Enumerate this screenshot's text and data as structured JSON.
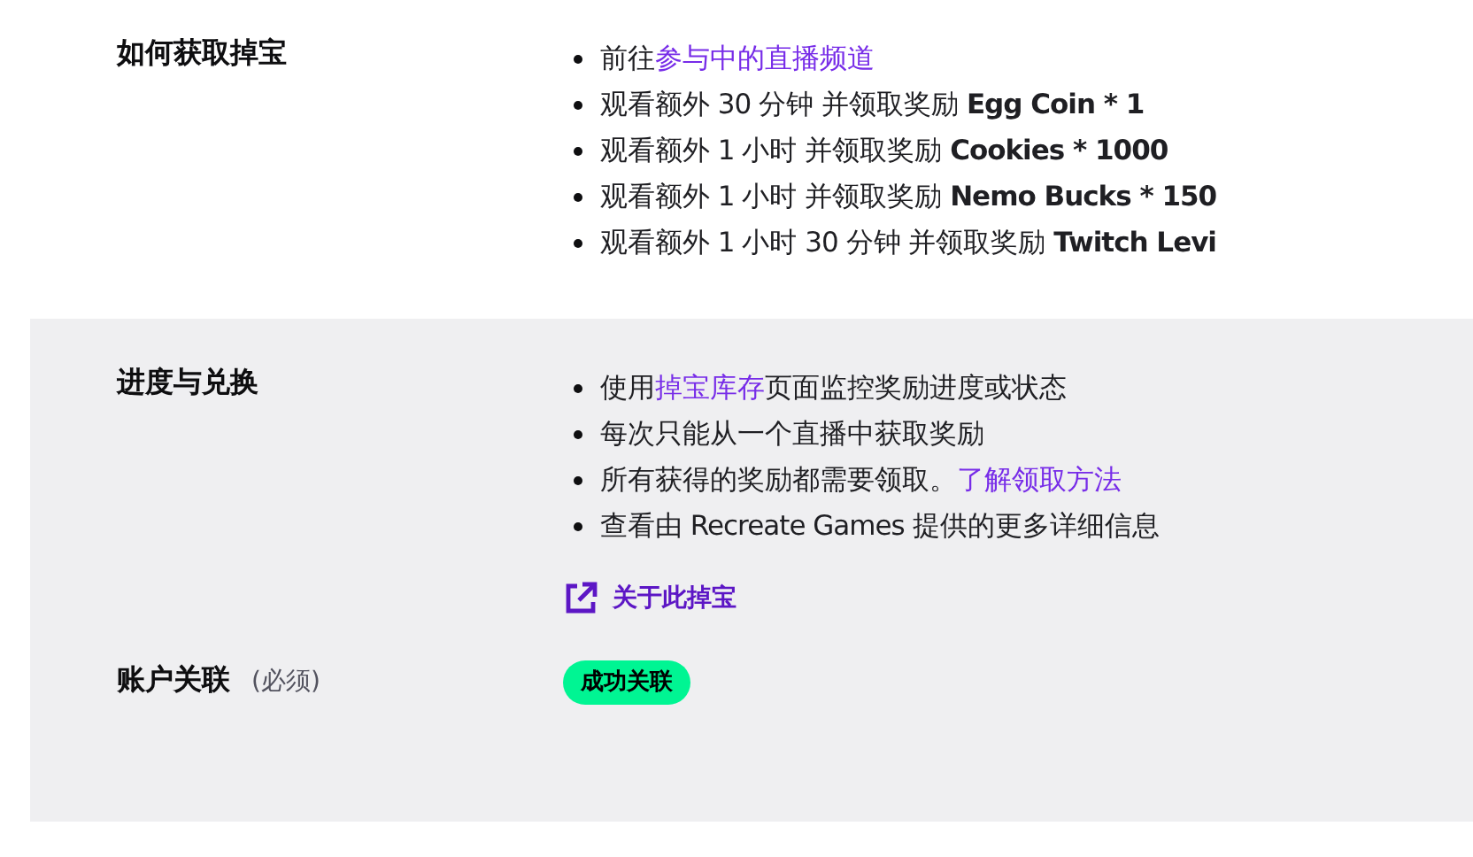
{
  "sections": [
    {
      "shaded": false,
      "label": "如何获取掉宝",
      "items": [
        [
          {
            "kind": "text",
            "text": "前往"
          },
          {
            "kind": "link",
            "text": "参与中的直播频道"
          }
        ],
        [
          {
            "kind": "text",
            "text": "观看额外 30 分钟 并领取奖励 "
          },
          {
            "kind": "bold",
            "text": "Egg Coin * 1"
          }
        ],
        [
          {
            "kind": "text",
            "text": "观看额外 1 小时 并领取奖励 "
          },
          {
            "kind": "bold",
            "text": "Cookies * 1000"
          }
        ],
        [
          {
            "kind": "text",
            "text": "观看额外 1 小时 并领取奖励 "
          },
          {
            "kind": "bold",
            "text": "Nemo Bucks * 150"
          }
        ],
        [
          {
            "kind": "text",
            "text": "观看额外 1 小时 30 分钟 并领取奖励 "
          },
          {
            "kind": "bold",
            "text": "Twitch Levi"
          }
        ]
      ]
    },
    {
      "shaded": true,
      "label": "进度与兑换",
      "items": [
        [
          {
            "kind": "text",
            "text": "使用"
          },
          {
            "kind": "link",
            "text": "掉宝库存"
          },
          {
            "kind": "text",
            "text": "页面监控奖励进度或状态"
          }
        ],
        [
          {
            "kind": "text",
            "text": "每次只能从一个直播中获取奖励"
          }
        ],
        [
          {
            "kind": "text",
            "text": "所有获得的奖励都需要领取。"
          },
          {
            "kind": "link",
            "text": "了解领取方法"
          }
        ],
        [
          {
            "kind": "text",
            "text": "查看由 Recreate Games 提供的更多详细信息"
          }
        ]
      ],
      "external_link": "关于此掉宝",
      "account": {
        "label": "账户关联",
        "note": "(必须)",
        "status": "成功关联"
      }
    }
  ]
}
